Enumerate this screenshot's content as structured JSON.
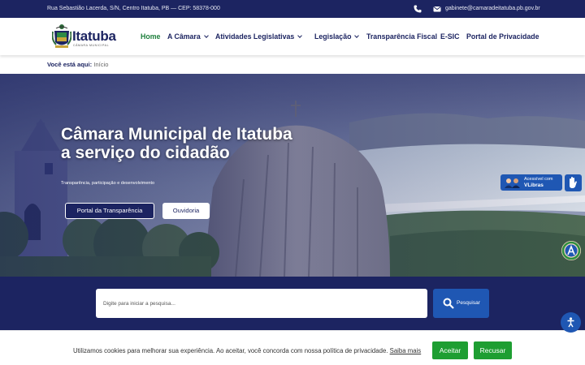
{
  "topbar": {
    "address": "Rua Sebastião Lacerda, S/N, Centro Itatuba, PB — CEP: 58378-000",
    "email": "gabinete@camaradeitatuba.pb.gov.br"
  },
  "logo": {
    "name": "Itatuba",
    "tagline": "CÂMARA MUNICIPAL"
  },
  "nav": [
    {
      "label": "Home",
      "active": true
    },
    {
      "label": "A Câmara",
      "dropdown": true
    },
    {
      "label": "Atividades Legislativas",
      "dropdown": true
    },
    {
      "label": "Legislação",
      "dropdown": true
    },
    {
      "label": "Transparência Fiscal"
    },
    {
      "label": "E-SIC"
    },
    {
      "label": "Portal de Privacidade"
    }
  ],
  "breadcrumb": {
    "prefix": "Você está aqui:",
    "current": "Início"
  },
  "hero": {
    "title": "Câmara Municipal de Itatuba a serviço do cidadão",
    "subtitle": "Transparência, participação e desenvolvimento",
    "primary_button": "Portal da Transparência",
    "secondary_button": "Ouvidoria"
  },
  "vlibras": {
    "line1": "Acessível com",
    "line2": "VLibras"
  },
  "search": {
    "placeholder": "Digite para iniciar a pesquisa...",
    "button": "Pesquisar"
  },
  "cookie": {
    "text": "Utilizamos cookies para melhorar sua experiência. Ao aceitar, você concorda com nossa política de privacidade.",
    "more": "Saiba mais",
    "accept": "Aceitar",
    "reject": "Recusar"
  },
  "colors": {
    "navy": "#1c2461",
    "blue": "#1f57b3",
    "green": "#1e9e32",
    "active_nav": "#1e7f3c"
  }
}
